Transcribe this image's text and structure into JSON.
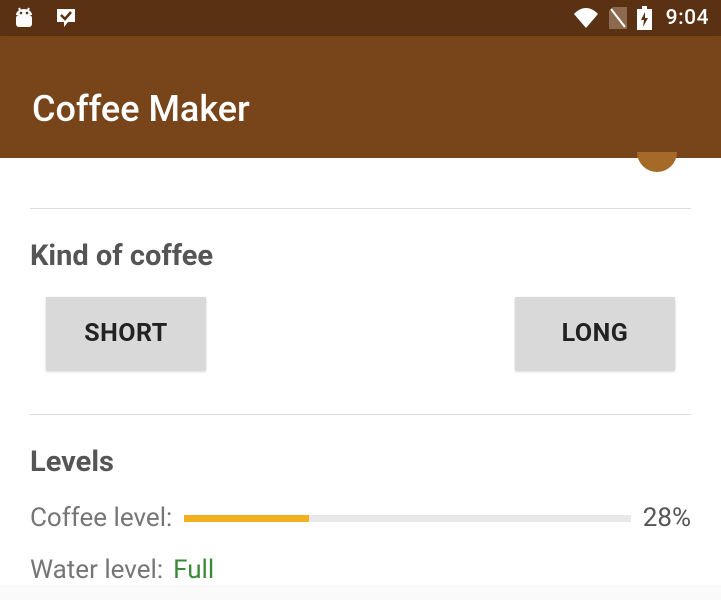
{
  "status": {
    "clock": "9:04"
  },
  "app": {
    "title": "Coffee Maker"
  },
  "sections": {
    "kind": {
      "title": "Kind of coffee",
      "buttons": {
        "short": "SHORT",
        "long": "LONG"
      }
    },
    "levels": {
      "title": "Levels",
      "coffee": {
        "label": "Coffee level:",
        "percent": 28,
        "percent_text": "28%"
      },
      "water": {
        "label": "Water level:",
        "value": "Full"
      }
    }
  },
  "colors": {
    "accent": "#a56928",
    "appbar": "#78451b",
    "statusbar": "#5a3213",
    "progress": "#f2b01e",
    "water_value": "#3a8a38"
  }
}
